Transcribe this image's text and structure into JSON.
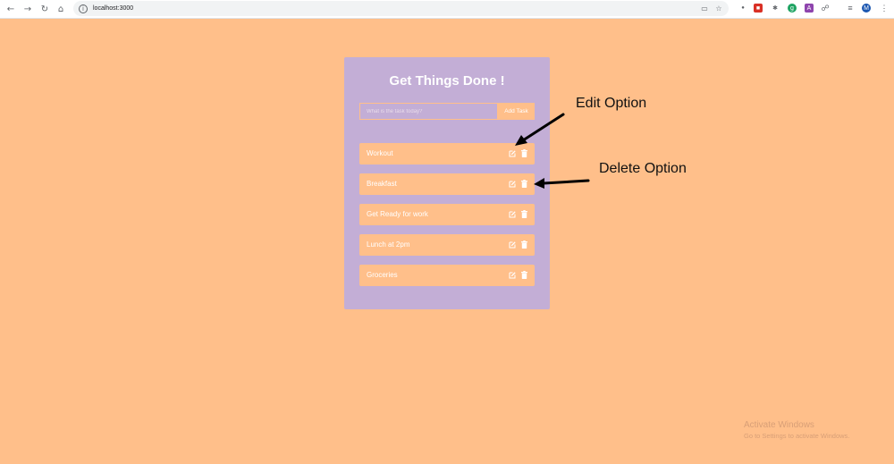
{
  "browser": {
    "url": "localhost:3000",
    "profile_initial": "M"
  },
  "app": {
    "title": "Get Things Done !",
    "input_placeholder": "What is the task today?",
    "add_button": "Add Task",
    "tasks": [
      {
        "label": "Workout"
      },
      {
        "label": "Breakfast"
      },
      {
        "label": "Get Ready for work"
      },
      {
        "label": "Lunch at 2pm"
      },
      {
        "label": "Groceries"
      }
    ]
  },
  "annotations": {
    "edit_label": "Edit Option",
    "delete_label": "Delete Option"
  },
  "watermark": {
    "line1": "Activate Windows",
    "line2": "Go to Settings to activate Windows."
  },
  "colors": {
    "page_background": "#ffbf8a",
    "card_background": "#c3aed6",
    "task_background": "#ffbf8a",
    "text": "#ffffff"
  }
}
